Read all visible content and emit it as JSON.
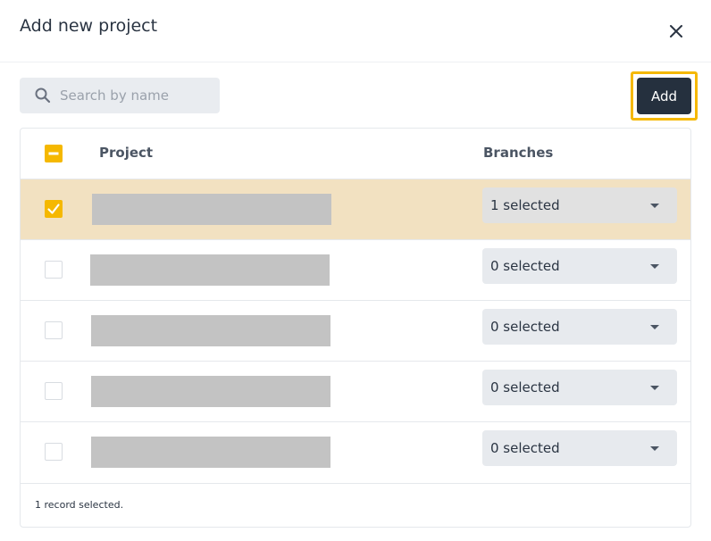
{
  "dialog": {
    "title": "Add new project"
  },
  "search": {
    "placeholder": "Search by name",
    "value": ""
  },
  "toolbar": {
    "add_label": "Add"
  },
  "table": {
    "headers": {
      "project": "Project",
      "branches": "Branches"
    },
    "header_checkbox": "indeterminate",
    "rows": [
      {
        "checked": true,
        "project_name": "",
        "branches": "1 selected"
      },
      {
        "checked": false,
        "project_name": "",
        "branches": "0 selected"
      },
      {
        "checked": false,
        "project_name": "",
        "branches": "0 selected"
      },
      {
        "checked": false,
        "project_name": "",
        "branches": "0 selected"
      },
      {
        "checked": false,
        "project_name": "",
        "branches": "0 selected"
      }
    ]
  },
  "footer": {
    "status": "1 record selected."
  },
  "colors": {
    "accent": "#f5b800",
    "primary_button": "#25303e",
    "selected_row": "#f2e1c1",
    "redacted_block": "#c3c3c3"
  }
}
